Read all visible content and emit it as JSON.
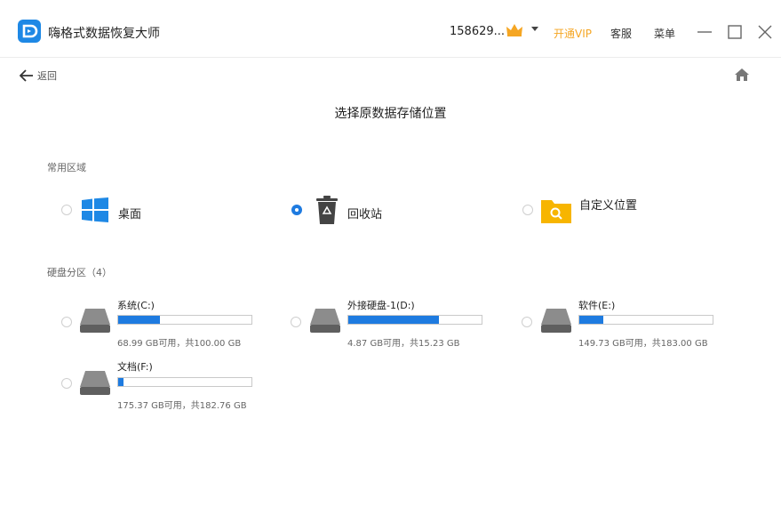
{
  "app": {
    "title": "嗨格式数据恢复大师"
  },
  "header": {
    "username": "158629...",
    "vip_label": "开通VIP",
    "service_label": "客服",
    "menu_label": "菜单",
    "accent_color": "#1e7be0",
    "vip_color": "#f5a623"
  },
  "nav": {
    "back_label": "返回"
  },
  "page": {
    "title": "选择原数据存储位置"
  },
  "common": {
    "label": "常用区域",
    "items": [
      {
        "label": "桌面",
        "icon": "windows-icon",
        "selected": false
      },
      {
        "label": "回收站",
        "icon": "recycle-bin-icon",
        "selected": true
      },
      {
        "label": "自定义位置",
        "icon": "folder-search-icon",
        "selected": false
      }
    ]
  },
  "drives": {
    "label": "硬盘分区（4）",
    "items": [
      {
        "name": "系统(C:)",
        "info": "68.99 GB可用，共100.00 GB",
        "used_fraction": 0.31
      },
      {
        "name": "外接硬盘-1(D:)",
        "info": "4.87 GB可用，共15.23 GB",
        "used_fraction": 0.68
      },
      {
        "name": "软件(E:)",
        "info": "149.73 GB可用，共183.00 GB",
        "used_fraction": 0.18
      },
      {
        "name": "文档(F:)",
        "info": "175.37 GB可用，共182.76 GB",
        "used_fraction": 0.04
      }
    ]
  }
}
